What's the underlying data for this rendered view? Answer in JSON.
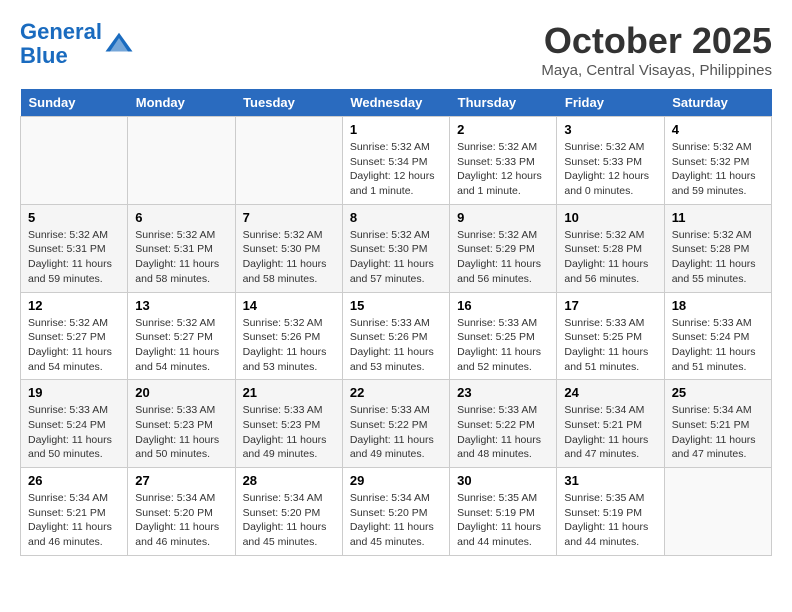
{
  "header": {
    "logo_line1": "General",
    "logo_line2": "Blue",
    "month": "October 2025",
    "location": "Maya, Central Visayas, Philippines"
  },
  "weekdays": [
    "Sunday",
    "Monday",
    "Tuesday",
    "Wednesday",
    "Thursday",
    "Friday",
    "Saturday"
  ],
  "weeks": [
    [
      {
        "day": "",
        "info": ""
      },
      {
        "day": "",
        "info": ""
      },
      {
        "day": "",
        "info": ""
      },
      {
        "day": "1",
        "info": "Sunrise: 5:32 AM\nSunset: 5:34 PM\nDaylight: 12 hours\nand 1 minute."
      },
      {
        "day": "2",
        "info": "Sunrise: 5:32 AM\nSunset: 5:33 PM\nDaylight: 12 hours\nand 1 minute."
      },
      {
        "day": "3",
        "info": "Sunrise: 5:32 AM\nSunset: 5:33 PM\nDaylight: 12 hours\nand 0 minutes."
      },
      {
        "day": "4",
        "info": "Sunrise: 5:32 AM\nSunset: 5:32 PM\nDaylight: 11 hours\nand 59 minutes."
      }
    ],
    [
      {
        "day": "5",
        "info": "Sunrise: 5:32 AM\nSunset: 5:31 PM\nDaylight: 11 hours\nand 59 minutes."
      },
      {
        "day": "6",
        "info": "Sunrise: 5:32 AM\nSunset: 5:31 PM\nDaylight: 11 hours\nand 58 minutes."
      },
      {
        "day": "7",
        "info": "Sunrise: 5:32 AM\nSunset: 5:30 PM\nDaylight: 11 hours\nand 58 minutes."
      },
      {
        "day": "8",
        "info": "Sunrise: 5:32 AM\nSunset: 5:30 PM\nDaylight: 11 hours\nand 57 minutes."
      },
      {
        "day": "9",
        "info": "Sunrise: 5:32 AM\nSunset: 5:29 PM\nDaylight: 11 hours\nand 56 minutes."
      },
      {
        "day": "10",
        "info": "Sunrise: 5:32 AM\nSunset: 5:28 PM\nDaylight: 11 hours\nand 56 minutes."
      },
      {
        "day": "11",
        "info": "Sunrise: 5:32 AM\nSunset: 5:28 PM\nDaylight: 11 hours\nand 55 minutes."
      }
    ],
    [
      {
        "day": "12",
        "info": "Sunrise: 5:32 AM\nSunset: 5:27 PM\nDaylight: 11 hours\nand 54 minutes."
      },
      {
        "day": "13",
        "info": "Sunrise: 5:32 AM\nSunset: 5:27 PM\nDaylight: 11 hours\nand 54 minutes."
      },
      {
        "day": "14",
        "info": "Sunrise: 5:32 AM\nSunset: 5:26 PM\nDaylight: 11 hours\nand 53 minutes."
      },
      {
        "day": "15",
        "info": "Sunrise: 5:33 AM\nSunset: 5:26 PM\nDaylight: 11 hours\nand 53 minutes."
      },
      {
        "day": "16",
        "info": "Sunrise: 5:33 AM\nSunset: 5:25 PM\nDaylight: 11 hours\nand 52 minutes."
      },
      {
        "day": "17",
        "info": "Sunrise: 5:33 AM\nSunset: 5:25 PM\nDaylight: 11 hours\nand 51 minutes."
      },
      {
        "day": "18",
        "info": "Sunrise: 5:33 AM\nSunset: 5:24 PM\nDaylight: 11 hours\nand 51 minutes."
      }
    ],
    [
      {
        "day": "19",
        "info": "Sunrise: 5:33 AM\nSunset: 5:24 PM\nDaylight: 11 hours\nand 50 minutes."
      },
      {
        "day": "20",
        "info": "Sunrise: 5:33 AM\nSunset: 5:23 PM\nDaylight: 11 hours\nand 50 minutes."
      },
      {
        "day": "21",
        "info": "Sunrise: 5:33 AM\nSunset: 5:23 PM\nDaylight: 11 hours\nand 49 minutes."
      },
      {
        "day": "22",
        "info": "Sunrise: 5:33 AM\nSunset: 5:22 PM\nDaylight: 11 hours\nand 49 minutes."
      },
      {
        "day": "23",
        "info": "Sunrise: 5:33 AM\nSunset: 5:22 PM\nDaylight: 11 hours\nand 48 minutes."
      },
      {
        "day": "24",
        "info": "Sunrise: 5:34 AM\nSunset: 5:21 PM\nDaylight: 11 hours\nand 47 minutes."
      },
      {
        "day": "25",
        "info": "Sunrise: 5:34 AM\nSunset: 5:21 PM\nDaylight: 11 hours\nand 47 minutes."
      }
    ],
    [
      {
        "day": "26",
        "info": "Sunrise: 5:34 AM\nSunset: 5:21 PM\nDaylight: 11 hours\nand 46 minutes."
      },
      {
        "day": "27",
        "info": "Sunrise: 5:34 AM\nSunset: 5:20 PM\nDaylight: 11 hours\nand 46 minutes."
      },
      {
        "day": "28",
        "info": "Sunrise: 5:34 AM\nSunset: 5:20 PM\nDaylight: 11 hours\nand 45 minutes."
      },
      {
        "day": "29",
        "info": "Sunrise: 5:34 AM\nSunset: 5:20 PM\nDaylight: 11 hours\nand 45 minutes."
      },
      {
        "day": "30",
        "info": "Sunrise: 5:35 AM\nSunset: 5:19 PM\nDaylight: 11 hours\nand 44 minutes."
      },
      {
        "day": "31",
        "info": "Sunrise: 5:35 AM\nSunset: 5:19 PM\nDaylight: 11 hours\nand 44 minutes."
      },
      {
        "day": "",
        "info": ""
      }
    ]
  ]
}
